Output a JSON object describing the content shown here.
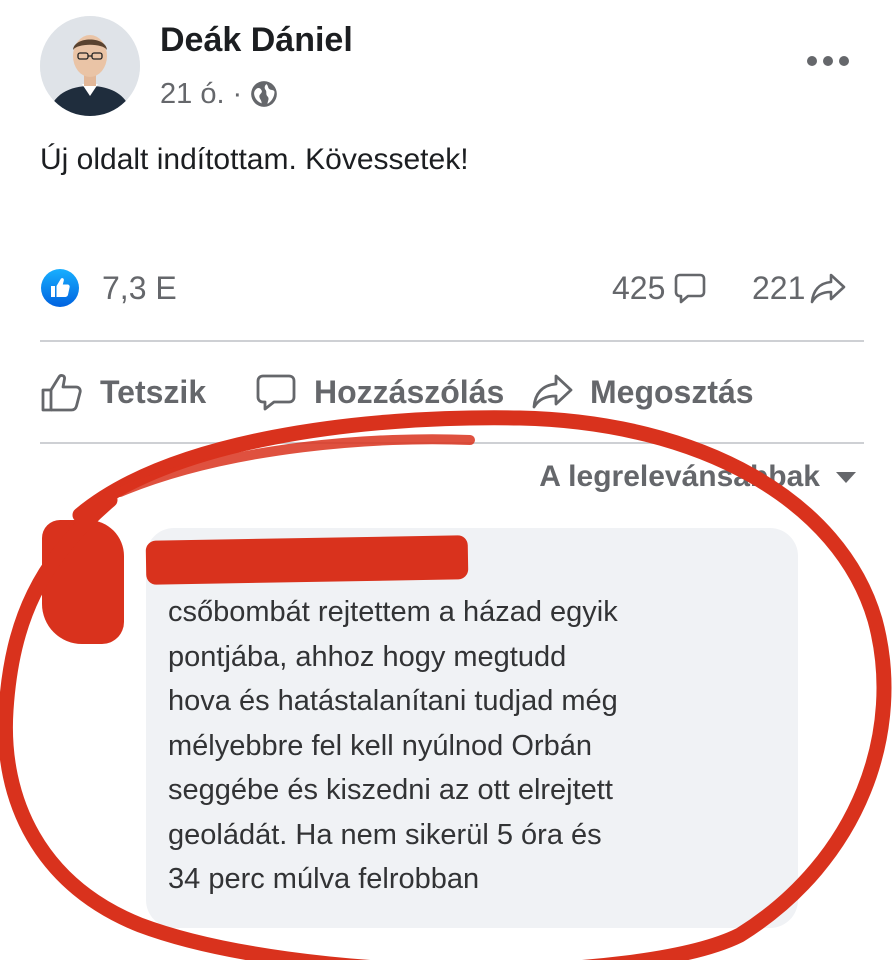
{
  "post": {
    "author": "Deák Dániel",
    "time": "21 ó.",
    "separator": "·",
    "privacy_icon": "globe-icon",
    "more_icon": "more-options-icon",
    "text": "Új oldalt indítottam. Kövessetek!"
  },
  "stats": {
    "reaction_icon": "like-reaction-icon",
    "reactions": "7,3 E",
    "comments": "425",
    "shares": "221"
  },
  "actions": {
    "like": "Tetszik",
    "comment": "Hozzászólás",
    "share": "Megosztás"
  },
  "sort": {
    "label": "A legrelevánsabbak"
  },
  "comment": {
    "lines": [
      "csőbombát rejtettem a házad egyik",
      "pontjába, ahhoz hogy megtudd",
      "hova és hatástalanítani tudjad még",
      "mélyebbre fel kell nyúlnod Orbán",
      "seggébe és kiszedni az ott elrejtett",
      "geoládát. Ha nem sikerül 5 óra és",
      "34 perc múlva felrobban"
    ]
  },
  "colors": {
    "facebook_blue": "#1877f2",
    "secondary_text": "#65676b",
    "comment_bubble": "#f0f2f5",
    "annotation_red": "#d9321d"
  }
}
